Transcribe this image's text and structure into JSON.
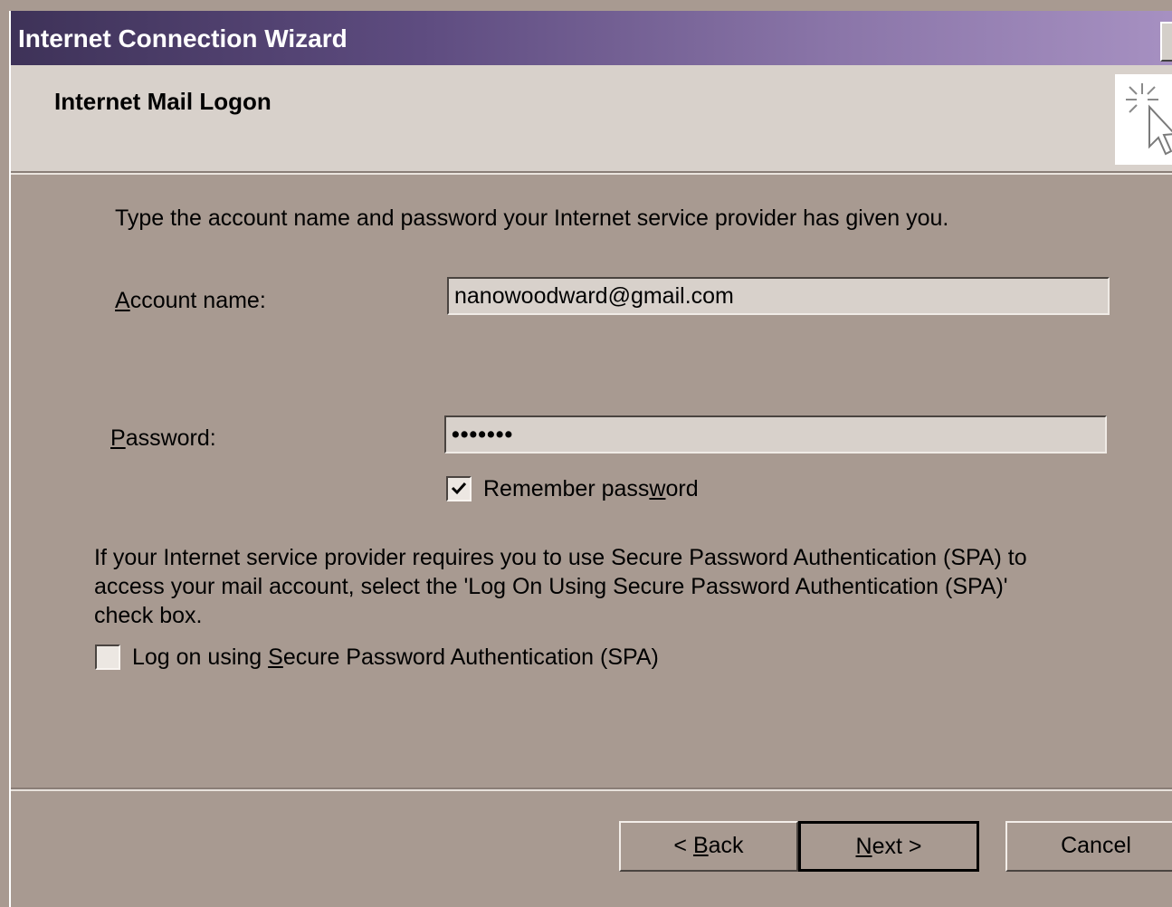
{
  "window": {
    "title": "Internet Connection Wizard"
  },
  "header": {
    "title": "Internet Mail Logon",
    "icon": "wizard-sparkle-cursor-icon"
  },
  "intro": {
    "text": "Type the account name and password your Internet service provider has given you."
  },
  "account": {
    "label_prefix": "",
    "label_accel": "A",
    "label_rest": "ccount name:",
    "value": "nanowoodward@gmail.com"
  },
  "password": {
    "label_accel": "P",
    "label_rest": "assword:",
    "value_masked": "•••••••"
  },
  "remember": {
    "label_pre": "Remember pass",
    "label_accel": "w",
    "label_post": "ord",
    "checked": true
  },
  "spa": {
    "info_line1": "If your Internet service provider requires you to use Secure Password Authentication (SPA) to",
    "info_line2": "access your mail account, select the 'Log On Using Secure Password Authentication (SPA)'",
    "info_line3": "check box.",
    "checkbox_pre": "Log on using ",
    "checkbox_accel": "S",
    "checkbox_post": "ecure Password Authentication (SPA)",
    "checked": false
  },
  "buttons": {
    "back_pre": "< ",
    "back_accel": "B",
    "back_post": "ack",
    "next_accel": "N",
    "next_post": "ext >",
    "cancel": "Cancel"
  }
}
